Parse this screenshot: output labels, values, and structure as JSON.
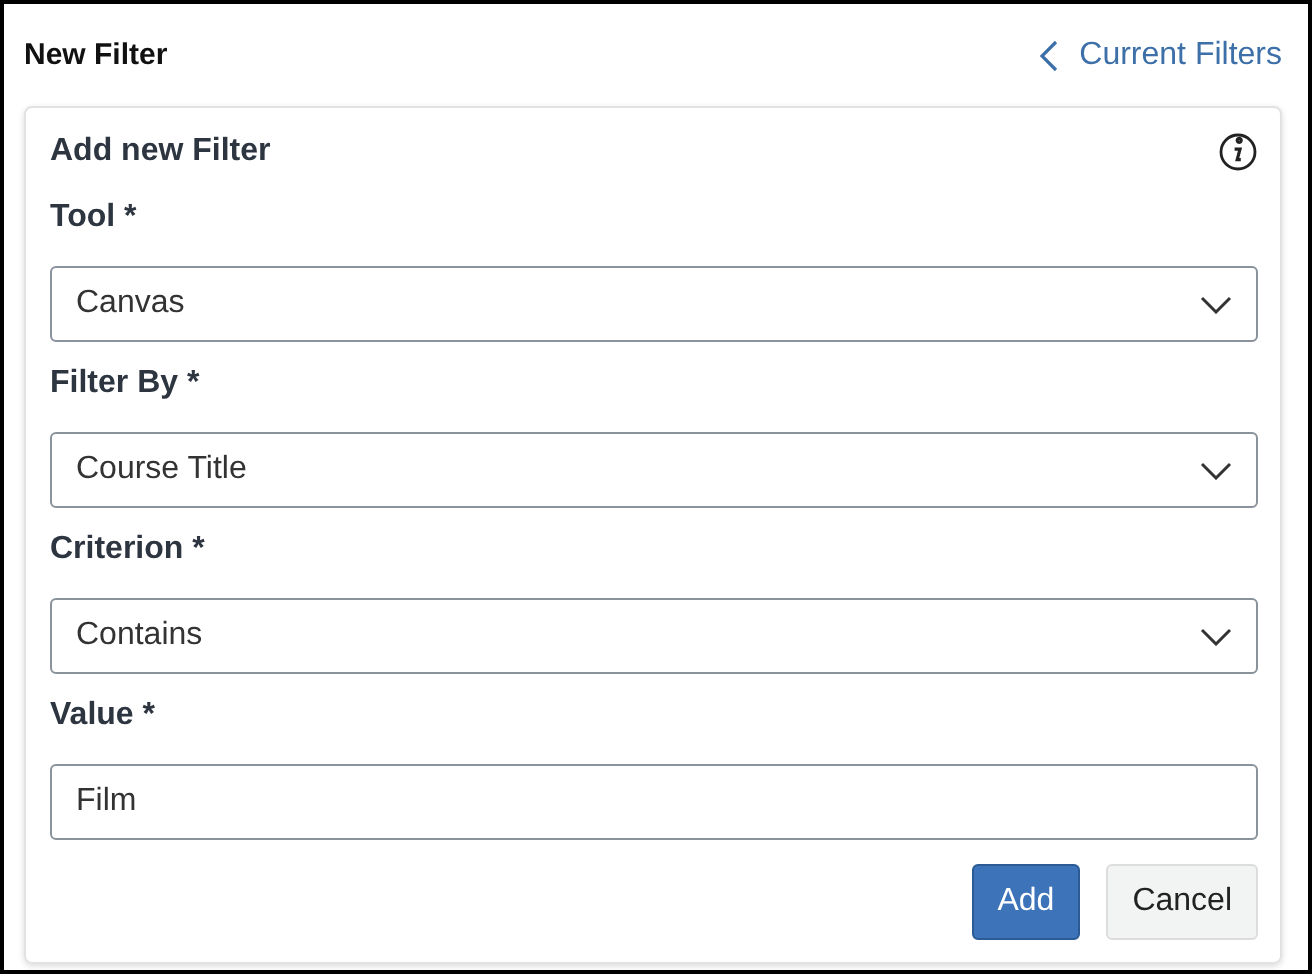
{
  "header": {
    "title": "New Filter",
    "back_link": "Current Filters"
  },
  "card": {
    "title": "Add new Filter",
    "fields": [
      {
        "kind": "select",
        "label": "Tool *",
        "value": "Canvas"
      },
      {
        "kind": "select",
        "label": "Filter By *",
        "value": "Course Title"
      },
      {
        "kind": "select",
        "label": "Criterion *",
        "value": "Contains"
      },
      {
        "kind": "text",
        "label": "Value *",
        "value": "Film"
      }
    ],
    "buttons": [
      {
        "label": "Add",
        "kind": "primary"
      },
      {
        "label": "Cancel",
        "kind": "secondary"
      }
    ]
  }
}
